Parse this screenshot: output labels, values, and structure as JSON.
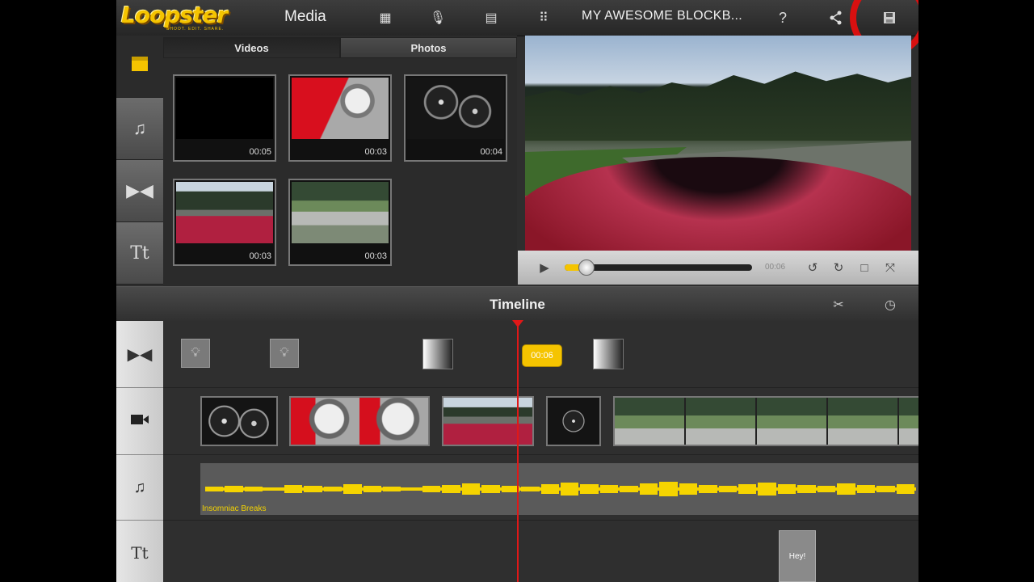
{
  "app": {
    "logo": "Loopster",
    "logo_tagline": "SHOOT. EDIT. SHARE."
  },
  "toolbar": {
    "media_label": "Media",
    "project_title": "MY AWESOME BLOCKB...",
    "icons": [
      "storyboard-icon",
      "microphone-icon",
      "clip-import-icon",
      "grid-icon",
      "help-icon",
      "share-icon",
      "save-icon"
    ]
  },
  "media_browser": {
    "tabs": [
      {
        "label": "Videos",
        "selected": true
      },
      {
        "label": "Photos",
        "selected": false
      }
    ],
    "videos": [
      {
        "duration": "00:05",
        "scene": "black"
      },
      {
        "duration": "00:03",
        "scene": "red-wheel"
      },
      {
        "duration": "00:04",
        "scene": "dashboard"
      },
      {
        "duration": "00:03",
        "scene": "red-hood-trees"
      },
      {
        "duration": "00:03",
        "scene": "track-car"
      }
    ]
  },
  "player": {
    "time": "00:06",
    "progress": 0.08
  },
  "timeline": {
    "title": "Timeline",
    "transition_tag": "00:06",
    "audio_track_name": "Insomniac Breaks",
    "title_clip": "Hey!"
  },
  "colors": {
    "accent": "#f5c400",
    "playhead": "#e01818",
    "highlight_ring": "#d81010"
  }
}
